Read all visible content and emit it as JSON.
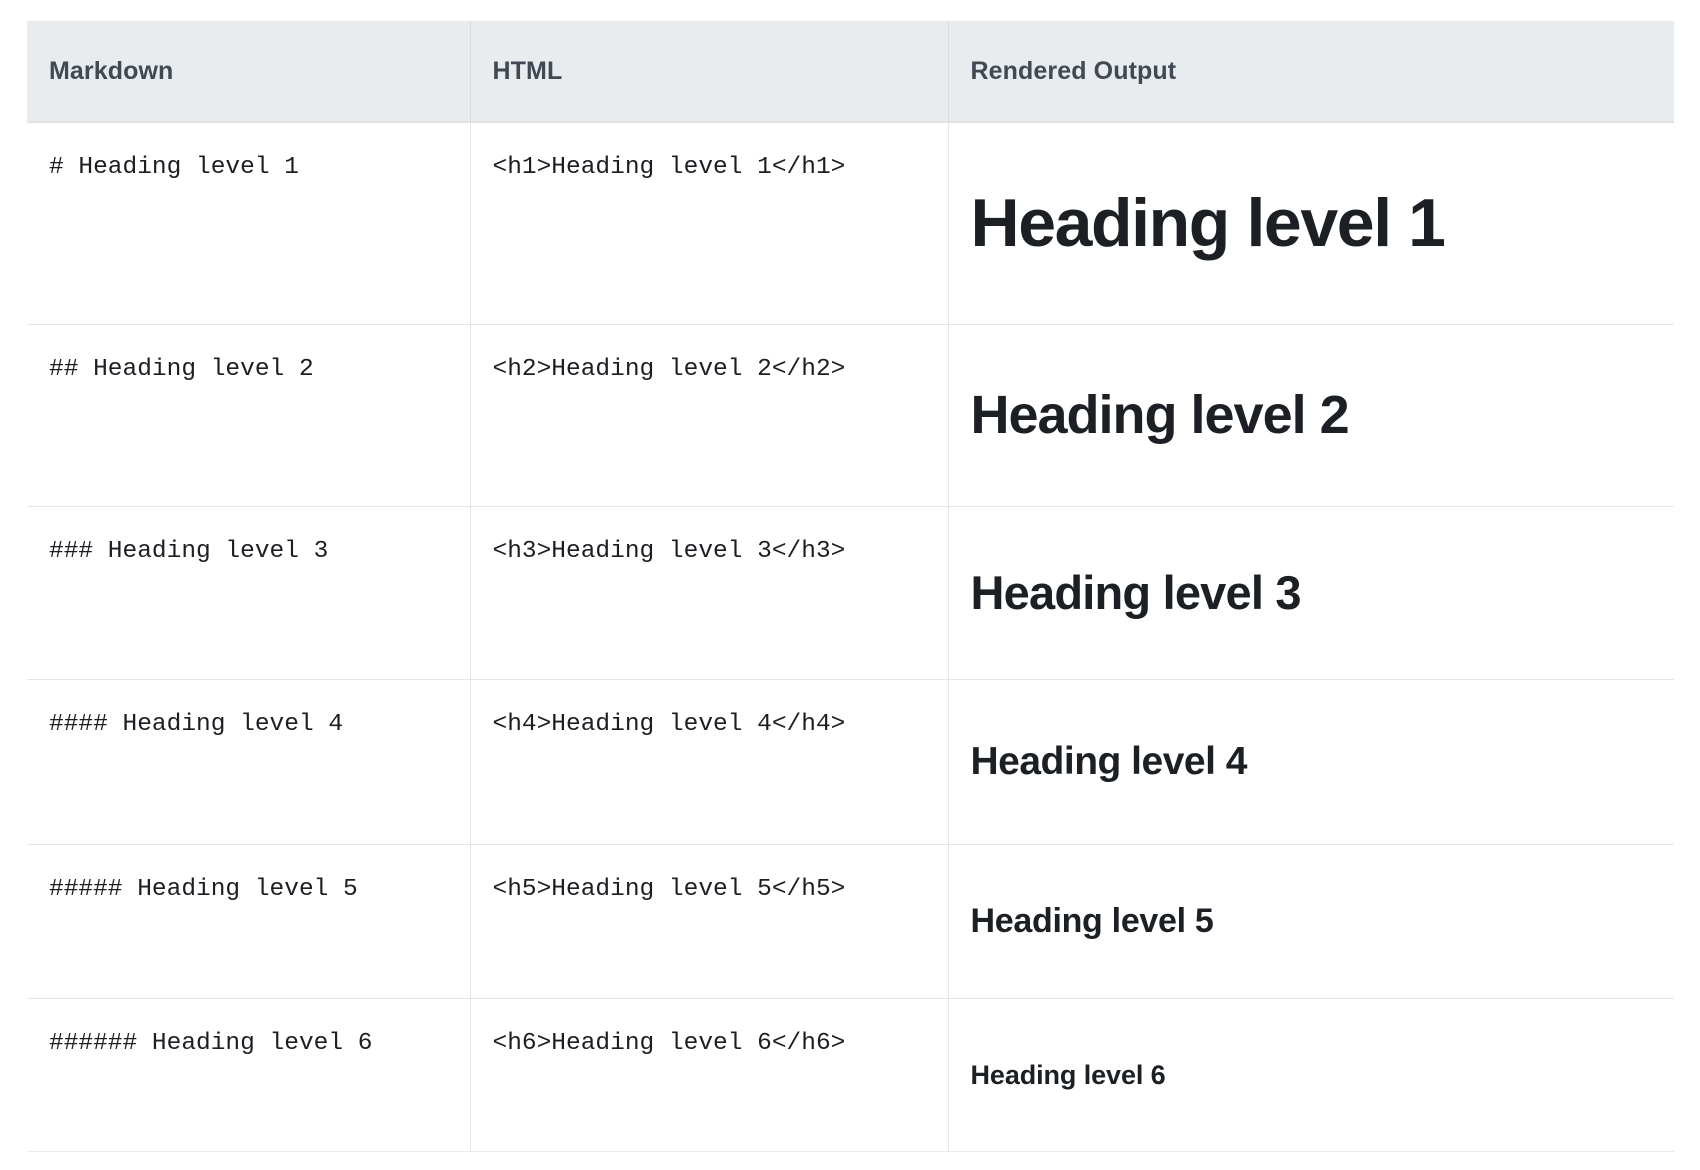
{
  "table": {
    "columns": [
      {
        "key": "markdown",
        "label": "Markdown"
      },
      {
        "key": "html",
        "label": "HTML"
      },
      {
        "key": "rendered",
        "label": "Rendered Output"
      }
    ],
    "rows": [
      {
        "markdown": "# Heading level 1",
        "html": "<h1>Heading level 1</h1>",
        "rendered": "Heading level 1",
        "level": 1
      },
      {
        "markdown": "## Heading level 2",
        "html": "<h2>Heading level 2</h2>",
        "rendered": "Heading level 2",
        "level": 2
      },
      {
        "markdown": "### Heading level 3",
        "html": "<h3>Heading level 3</h3>",
        "rendered": "Heading level 3",
        "level": 3
      },
      {
        "markdown": "#### Heading level 4",
        "html": "<h4>Heading level 4</h4>",
        "rendered": "Heading level 4",
        "level": 4
      },
      {
        "markdown": "##### Heading level 5",
        "html": "<h5>Heading level 5</h5>",
        "rendered": "Heading level 5",
        "level": 5
      },
      {
        "markdown": "###### Heading level 6",
        "html": "<h6>Heading level 6</h6>",
        "rendered": "Heading level 6",
        "level": 6
      }
    ]
  },
  "colors": {
    "header_background": "#e9ecef",
    "header_text": "#414a52",
    "code_text": "#1b1f23",
    "rendered_text": "#1c2024",
    "row_divider": "#e3e5e7",
    "page_background": "#ffffff"
  }
}
